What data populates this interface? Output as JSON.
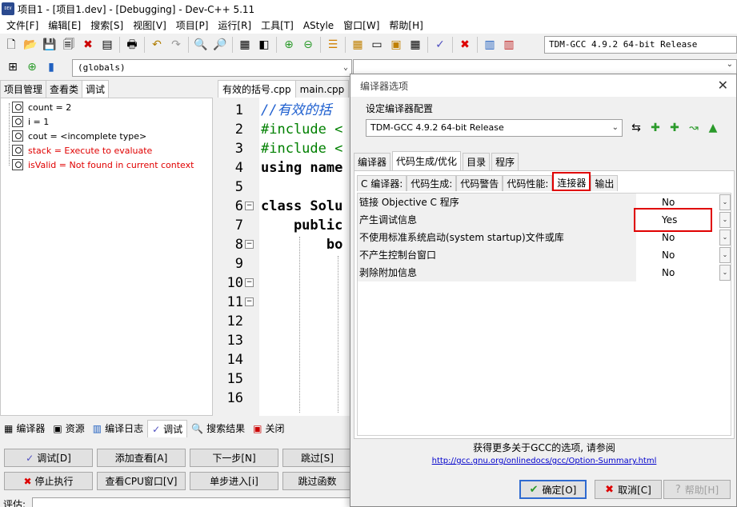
{
  "window": {
    "title": "项目1 - [项目1.dev] - [Debugging] - Dev-C++ 5.11",
    "app_icon_text": "DEV"
  },
  "menu": [
    "文件[F]",
    "编辑[E]",
    "搜索[S]",
    "视图[V]",
    "项目[P]",
    "运行[R]",
    "工具[T]",
    "AStyle",
    "窗口[W]",
    "帮助[H]"
  ],
  "toolbar": {
    "compiler_select": "TDM-GCC 4.9.2 64-bit Release",
    "scope_select": "(globals)"
  },
  "left_panel": {
    "tabs": [
      "项目管理",
      "查看类",
      "调试"
    ],
    "active_tab": "调试",
    "watches": [
      {
        "text": "count = 2",
        "error": false
      },
      {
        "text": "i = 1",
        "error": false
      },
      {
        "text": "cout = <incomplete type>",
        "error": false
      },
      {
        "text": "stack = Execute to evaluate",
        "error": true
      },
      {
        "text": "isValid = Not found in current context",
        "error": true
      }
    ]
  },
  "editor": {
    "tabs": [
      "有效的括号.cpp",
      "main.cpp"
    ],
    "active_tab": "有效的括号.cpp",
    "line_numbers": [
      "1",
      "2",
      "3",
      "4",
      "5",
      "6",
      "7",
      "8",
      "9",
      "10",
      "11",
      "12",
      "13",
      "14",
      "15",
      "16"
    ],
    "code": {
      "l1": "//有效的括",
      "l2": "#include <",
      "l3": "#include <",
      "l4": "using name",
      "l6": "class Solu",
      "l7": "    public",
      "l8": "        bo"
    }
  },
  "bottom_panel": {
    "tabs": [
      "编译器",
      "资源",
      "编译日志",
      "调试",
      "搜索结果",
      "关闭"
    ],
    "active_tab": "调试",
    "buttons": {
      "debug": "调试[D]",
      "add_watch": "添加查看[A]",
      "next_step": "下一步[N]",
      "skip": "跳过[S]",
      "stop": "停止执行",
      "cpu_window": "查看CPU窗口[V]",
      "step_into": "单步进入[i]",
      "skip_func": "跳过函数"
    },
    "eval_label": "评估:"
  },
  "dialog": {
    "title": "编译器选项",
    "config_label": "设定编译器配置",
    "config_value": "TDM-GCC 4.9.2 64-bit Release",
    "tabs": [
      "编译器",
      "代码生成/优化",
      "目录",
      "程序"
    ],
    "active_tab": "代码生成/优化",
    "subtabs": [
      "C 编译器:",
      "代码生成:",
      "代码警告",
      "代码性能:",
      "连接器",
      "输出"
    ],
    "active_subtab": "连接器",
    "rows": [
      {
        "label": "链接 Objective C 程序",
        "value": "No"
      },
      {
        "label": "产生调试信息",
        "value": "Yes"
      },
      {
        "label": "不使用标准系统启动(system startup)文件或库",
        "value": "No"
      },
      {
        "label": "不产生控制台窗口",
        "value": "No"
      },
      {
        "label": "剥除附加信息",
        "value": "No"
      }
    ],
    "info_text": "获得更多关于GCC的选项, 请参阅",
    "info_link": "http://gcc.gnu.org/onlinedocs/gcc/Option-Summary.html",
    "ok_button": "确定[O]",
    "cancel_button": "取消[C]",
    "help_button": "帮助[H]"
  },
  "colors": {
    "error": "#e00000",
    "comment": "#1e5fcf",
    "preprocessor": "#008000",
    "highlight": "#e00000",
    "link": "#0000cc"
  }
}
